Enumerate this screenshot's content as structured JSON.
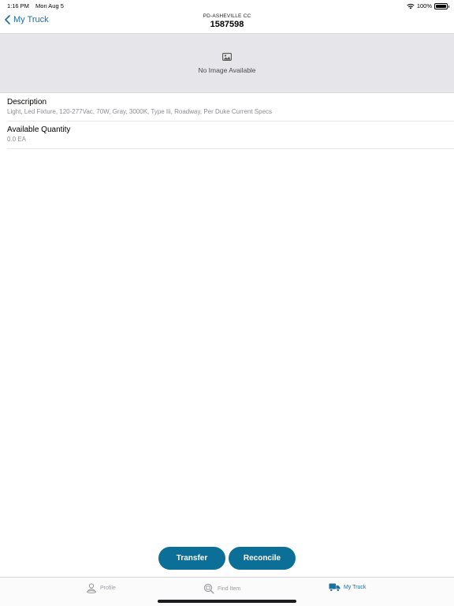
{
  "status": {
    "time": "1:16 PM",
    "date": "Mon Aug 5",
    "battery": "100%"
  },
  "nav": {
    "back_label": "My Truck",
    "subtitle": "PD-ASHEVILLE CC",
    "title": "1587598"
  },
  "image_area": {
    "text": "No Image Available",
    "icon": "image-icon"
  },
  "details": [
    {
      "label": "Description",
      "value": "Light, Led Fixture, 120-277Vac, 70W, Gray, 3000K, Type Iii, Roadway, Per Duke Current Specs"
    },
    {
      "label": "Available Quantity",
      "value": "0.0 EA"
    }
  ],
  "actions": {
    "transfer_label": "Transfer",
    "reconcile_label": "Reconcile",
    "button_color": "#0c6f97"
  },
  "tabs": [
    {
      "label": "Profile",
      "icon": "profile-icon"
    },
    {
      "label": "Find Item",
      "icon": "find-item-icon"
    },
    {
      "label": "My Truck",
      "icon": "truck-icon",
      "active": true
    }
  ],
  "colors": {
    "accent": "#1a6fa3",
    "inactive": "#9a9aa0",
    "image_bg": "#e6e6ea"
  }
}
